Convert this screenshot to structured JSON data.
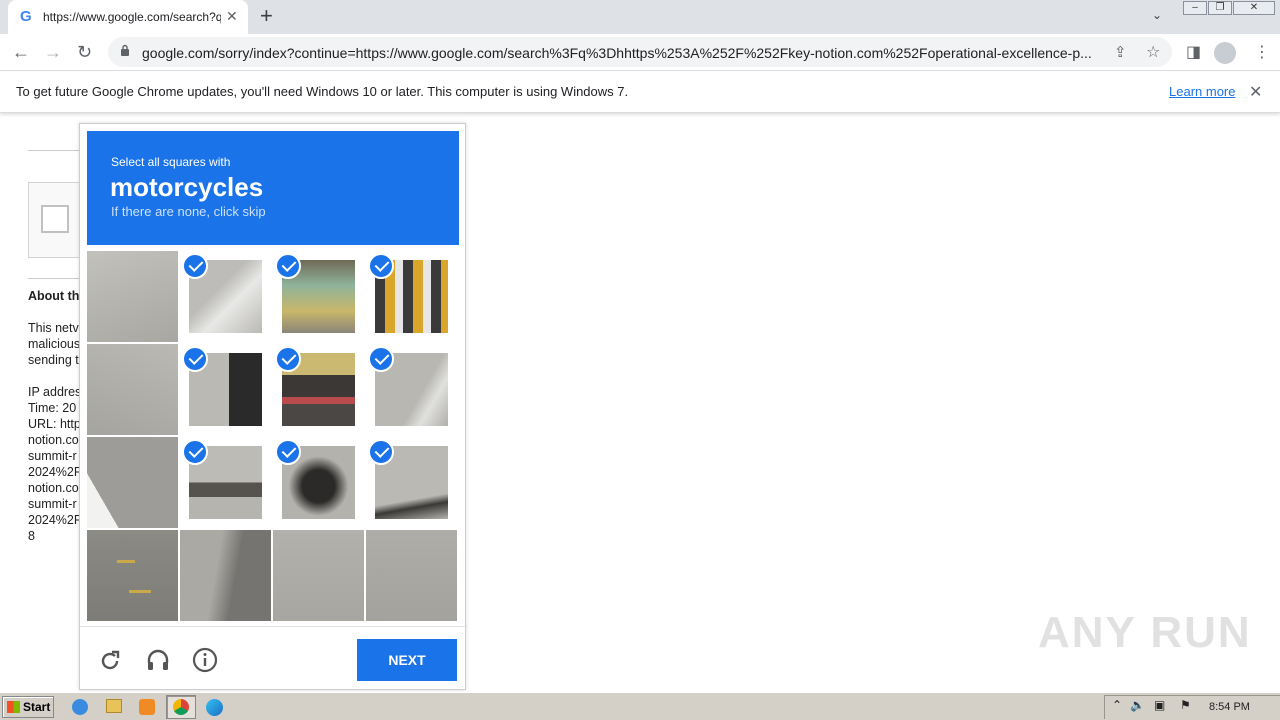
{
  "browser": {
    "tab_title": "https://www.google.com/search?q=",
    "url": "google.com/sorry/index?continue=https://www.google.com/search%3Fq%3Dhhttps%253A%252F%252Fkey-notion.com%252Foperational-excellence-p..."
  },
  "infobar": {
    "message": "To get future Google Chrome updates, you'll need Windows 10 or later. This computer is using Windows 7.",
    "learn_more": "Learn more"
  },
  "background_page": {
    "heading": "About th",
    "lines": [
      "This netv",
      "malicious",
      "sending t",
      "IP addres",
      "Time: 20",
      "URL: http",
      "notion.co",
      "summit-r",
      "2024%2F",
      "notion.co",
      "summit-r",
      "2024%2F",
      "8"
    ]
  },
  "captcha": {
    "instruction": "Select all squares with",
    "target": "motorcycles",
    "hint": "If there are none, click skip",
    "next_label": "NEXT",
    "selected_count": 9,
    "tiles_total": 16
  },
  "taskbar": {
    "start_label": "Start",
    "clock": "8:54 PM"
  },
  "watermark": "ANY RUN",
  "colors": {
    "captcha_blue": "#1a73e8",
    "tabstrip": "#dee1e6",
    "taskbar": "#d4d0c8"
  }
}
